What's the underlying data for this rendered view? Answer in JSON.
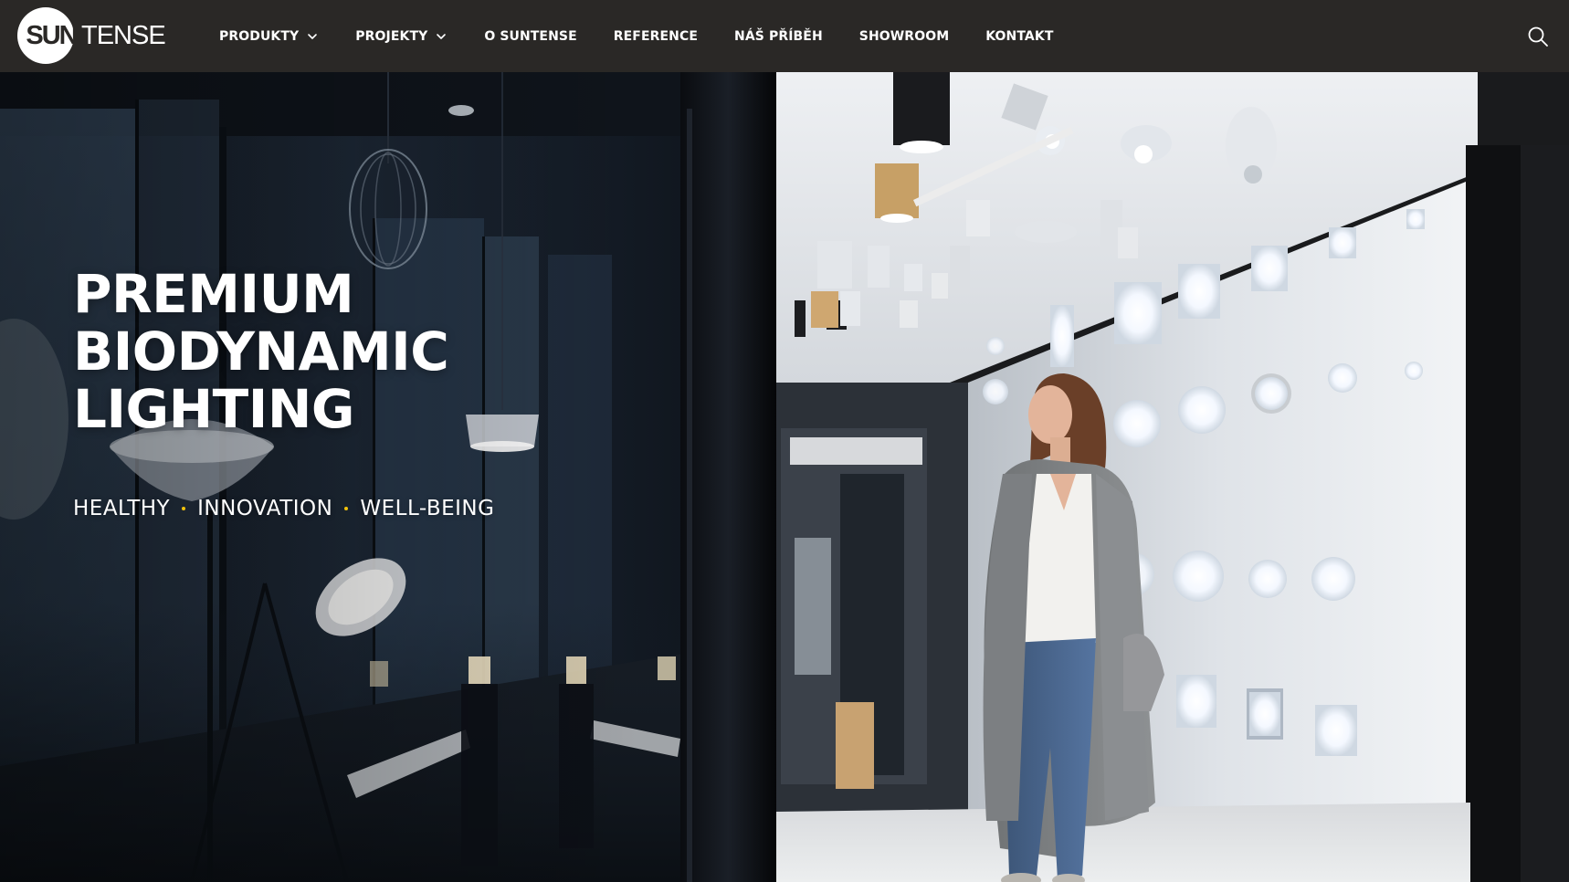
{
  "brand": {
    "logo_part1": "SUN",
    "logo_part2": "TENSE"
  },
  "nav": {
    "items": [
      {
        "label": "PRODUKTY",
        "has_dropdown": true
      },
      {
        "label": "PROJEKTY",
        "has_dropdown": true
      },
      {
        "label": "O SUNTENSE",
        "has_dropdown": false
      },
      {
        "label": "REFERENCE",
        "has_dropdown": false
      },
      {
        "label": "NÁŠ PŘÍBĚH",
        "has_dropdown": false
      },
      {
        "label": "SHOWROOM",
        "has_dropdown": false
      },
      {
        "label": "KONTAKT",
        "has_dropdown": false
      }
    ],
    "search_icon": "search-icon"
  },
  "hero": {
    "title_lines": [
      "PREMIUM",
      "BIODYNAMIC",
      "LIGHTING"
    ],
    "tagline": [
      "HEALTHY",
      "INNOVATION",
      "WELL-BEING"
    ]
  },
  "colors": {
    "header_bg": "#2a2826",
    "text": "#ffffff",
    "accent_dot": "#f2c20b"
  }
}
